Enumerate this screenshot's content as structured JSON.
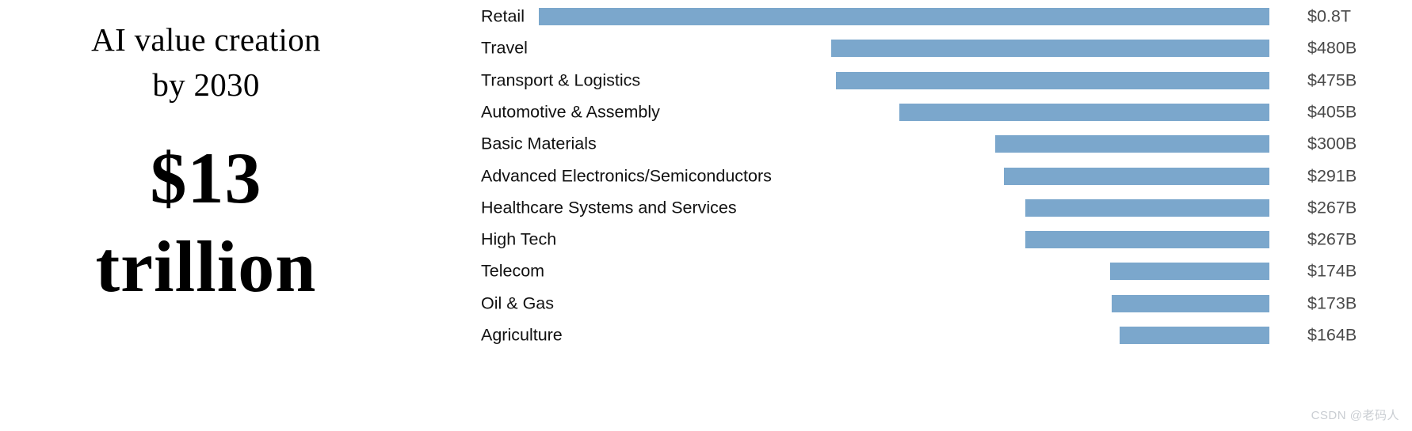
{
  "hero": {
    "title_line1": "AI value creation",
    "title_line2": "by 2030",
    "amount_line1": "$13",
    "amount_line2": "trillion"
  },
  "watermark": {
    "text": "CSDN @老码人"
  },
  "colors": {
    "bar": "#7BA7CC",
    "category_label": "#111111",
    "value_label": "#4a4a4a",
    "background": "#ffffff",
    "watermark": "#c9cdd2"
  },
  "chart_data": {
    "type": "bar",
    "orientation": "horizontal",
    "title": "AI value creation by 2030",
    "xlabel": "",
    "ylabel": "",
    "grid": false,
    "legend": "none",
    "xlim": [
      0,
      800
    ],
    "categories": [
      "Retail",
      "Travel",
      "Transport & Logistics",
      "Automotive & Assembly",
      "Basic Materials",
      "Advanced Electronics/Semiconductors",
      "Healthcare Systems and Services",
      "High Tech",
      "Telecom",
      "Oil & Gas",
      "Agriculture"
    ],
    "values": [
      800,
      480,
      475,
      405,
      300,
      291,
      267,
      267,
      174,
      173,
      164
    ],
    "value_labels": [
      "$0.8T",
      "$480B",
      "$475B",
      "$405B",
      "$300B",
      "$291B",
      "$267B",
      "$267B",
      "$174B",
      "$173B",
      "$164B"
    ],
    "units": "USD billions",
    "total_label": "$13 trillion"
  }
}
